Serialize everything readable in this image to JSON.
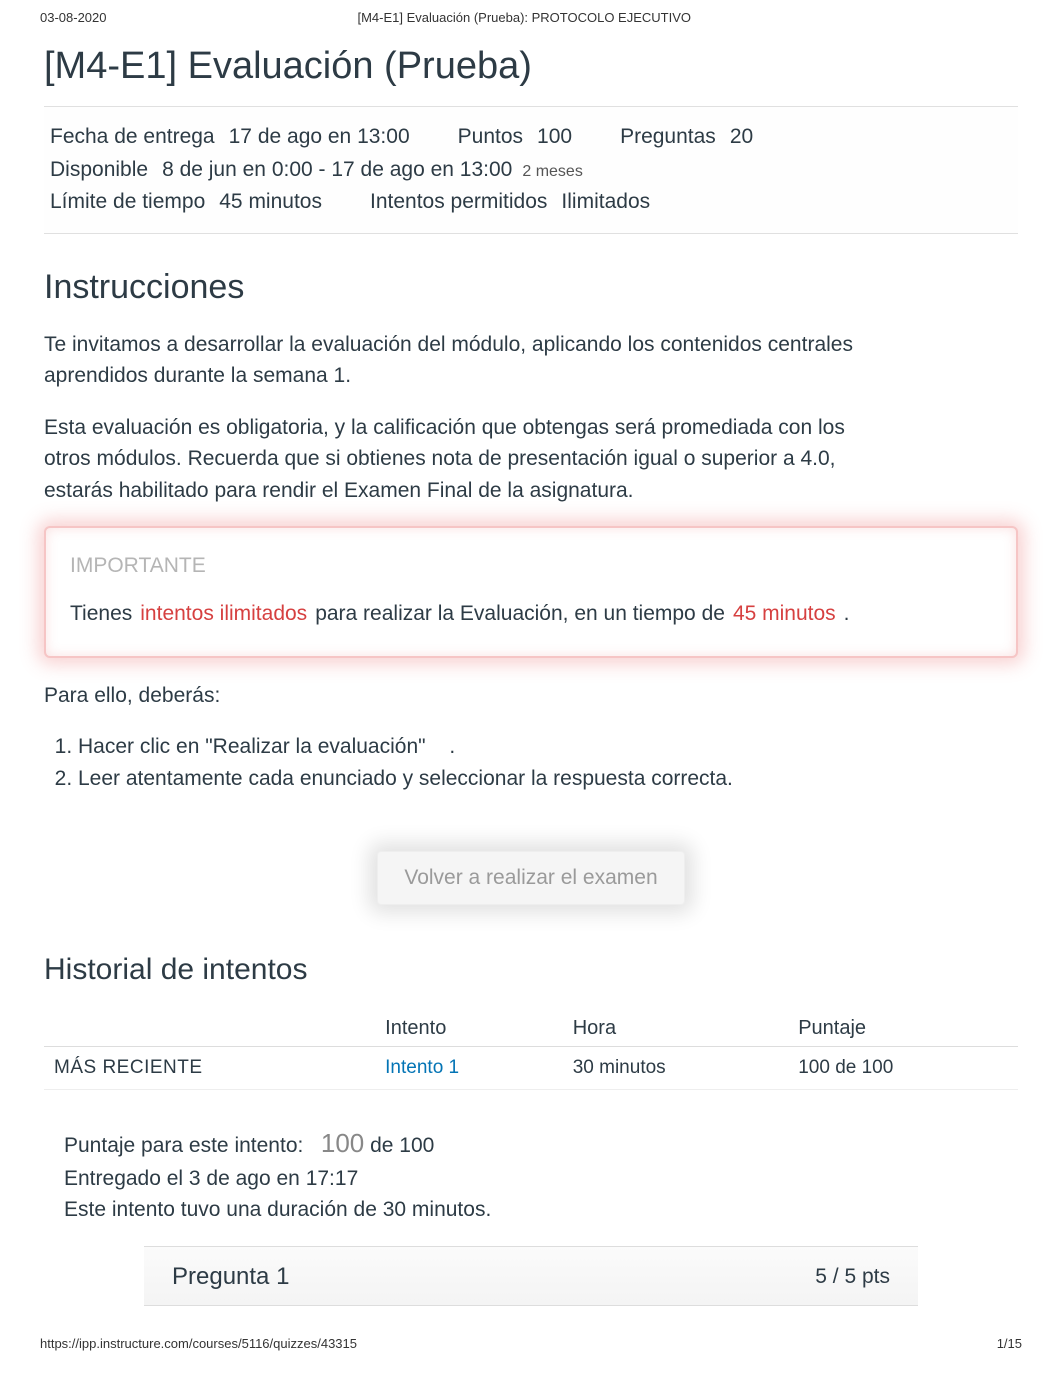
{
  "header": {
    "date": "03-08-2020",
    "doc_title": "[M4-E1] Evaluación (Prueba): PROTOCOLO EJECUTIVO"
  },
  "title": "[M4-E1] Evaluación (Prueba)",
  "meta": {
    "due_label": "Fecha de entrega",
    "due_value": "17 de ago en 13:00",
    "points_label": "Puntos",
    "points_value": "100",
    "questions_label": "Preguntas",
    "questions_value": "20",
    "available_label": "Disponible",
    "available_value": "8 de jun en 0:00 - 17 de ago en 13:00",
    "available_span": "2 meses",
    "timelimit_label": "Límite de tiempo",
    "timelimit_value": "45 minutos",
    "attempts_label": "Intentos permitidos",
    "attempts_value": "Ilimitados"
  },
  "instructions": {
    "heading": "Instrucciones",
    "p1": "Te invitamos a desarrollar la evaluación del módulo, aplicando los contenidos centrales aprendidos durante la semana 1.",
    "p2": "Esta evaluación es obligatoria, y la calificación que obtengas será promediada con los otros módulos. Recuerda que si obtienes nota de presentación igual o superior a 4.0, estarás habilitado para rendir el Examen Final de la asignatura."
  },
  "important": {
    "label": "IMPORTANTE",
    "t1": "Tienes",
    "red1": "intentos ilimitados",
    "t2": "para realizar la Evaluación, en un tiempo de",
    "red2": "45 minutos",
    "dot": "."
  },
  "steps": {
    "intro": "Para ello, deberás:",
    "s1a": "Hacer clic en ",
    "s1b": "\"Realizar la evaluación\"",
    "s1c": ".",
    "s2": "Leer atentamente cada enunciado y seleccionar la respuesta correcta."
  },
  "retake_btn": "Volver a realizar el examen",
  "history": {
    "heading": "Historial de intentos",
    "col_attempt": "Intento",
    "col_time": "Hora",
    "col_score": "Puntaje",
    "recent_label": "MÁS RECIENTE",
    "attempt_link": "Intento 1",
    "time_value": "30 minutos",
    "score_value": "100 de 100"
  },
  "score_summary": {
    "line1a": "Puntaje para este intento:",
    "line1_big": "100",
    "line1b": "de 100",
    "line2": "Entregado el 3 de ago en 17:17",
    "line3": "Este intento tuvo una duración de 30 minutos."
  },
  "question": {
    "label": "Pregunta 1",
    "pts": "5 / 5 pts"
  },
  "footer": {
    "url": "https://ipp.instructure.com/courses/5116/quizzes/43315",
    "page": "1/15"
  }
}
